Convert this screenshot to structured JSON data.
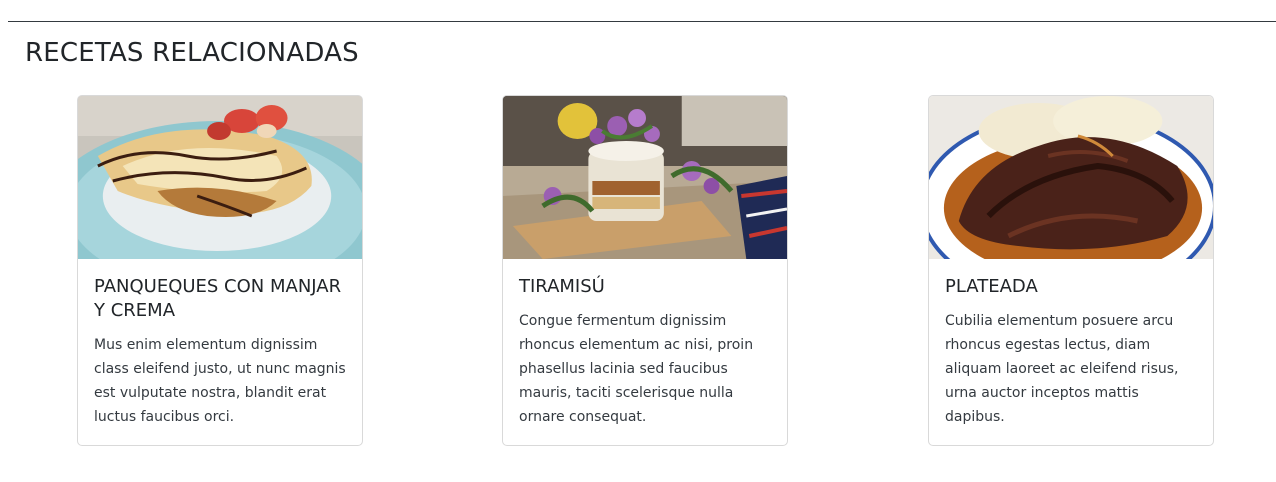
{
  "section": {
    "title": "RECETAS RELACIONADAS"
  },
  "cards": [
    {
      "title": "PANQUEQUES CON MANJAR Y CREMA",
      "text": "Mus enim elementum dignissim class eleifend justo, ut nunc magnis est vulputate nostra, blandit erat luctus faucibus orci."
    },
    {
      "title": "TIRAMISÚ",
      "text": "Congue fermentum dignissim rhoncus elementum ac nisi, proin phasellus lacinia sed faucibus mauris, taciti scelerisque nulla ornare consequat."
    },
    {
      "title": "PLATEADA",
      "text": "Cubilia elementum posuere arcu rhoncus egestas lectus, diam aliquam laoreet ac eleifend risus, urna auctor inceptos mattis dapibus."
    }
  ]
}
